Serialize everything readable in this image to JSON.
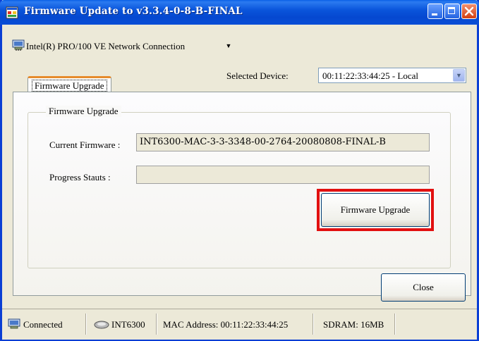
{
  "window": {
    "title": "Firmware Update to v3.3.4-0-8-B-FINAL"
  },
  "adapter": {
    "selected": "Intel(R) PRO/100 VE Network Connection"
  },
  "device": {
    "label": "Selected Device:",
    "value": "00:11:22:33:44:25 - Local"
  },
  "tabs": [
    {
      "label": "Firmware Upgrade",
      "active": true
    }
  ],
  "group": {
    "title": "Firmware Upgrade",
    "current_firmware_label": "Current Firmware :",
    "current_firmware_value": "INT6300-MAC-3-3-3348-00-2764-20080808-FINAL-B",
    "progress_label": "Progress Stauts :",
    "progress_value": "",
    "upgrade_button": "Firmware Upgrade"
  },
  "close_button": "Close",
  "statusbar": {
    "connection": "Connected",
    "chip": "INT6300",
    "mac": "MAC Address: 00:11:22:33:44:25",
    "sdram": "SDRAM: 16MB"
  },
  "icons": {
    "app": "window-app-icon",
    "network": "network-adapter-icon",
    "chip": "chip-icon"
  },
  "colors": {
    "titlebar": "#0a55db",
    "highlight": "#e21010",
    "tab_accent": "#e68b2c",
    "background": "#ece9d8"
  }
}
